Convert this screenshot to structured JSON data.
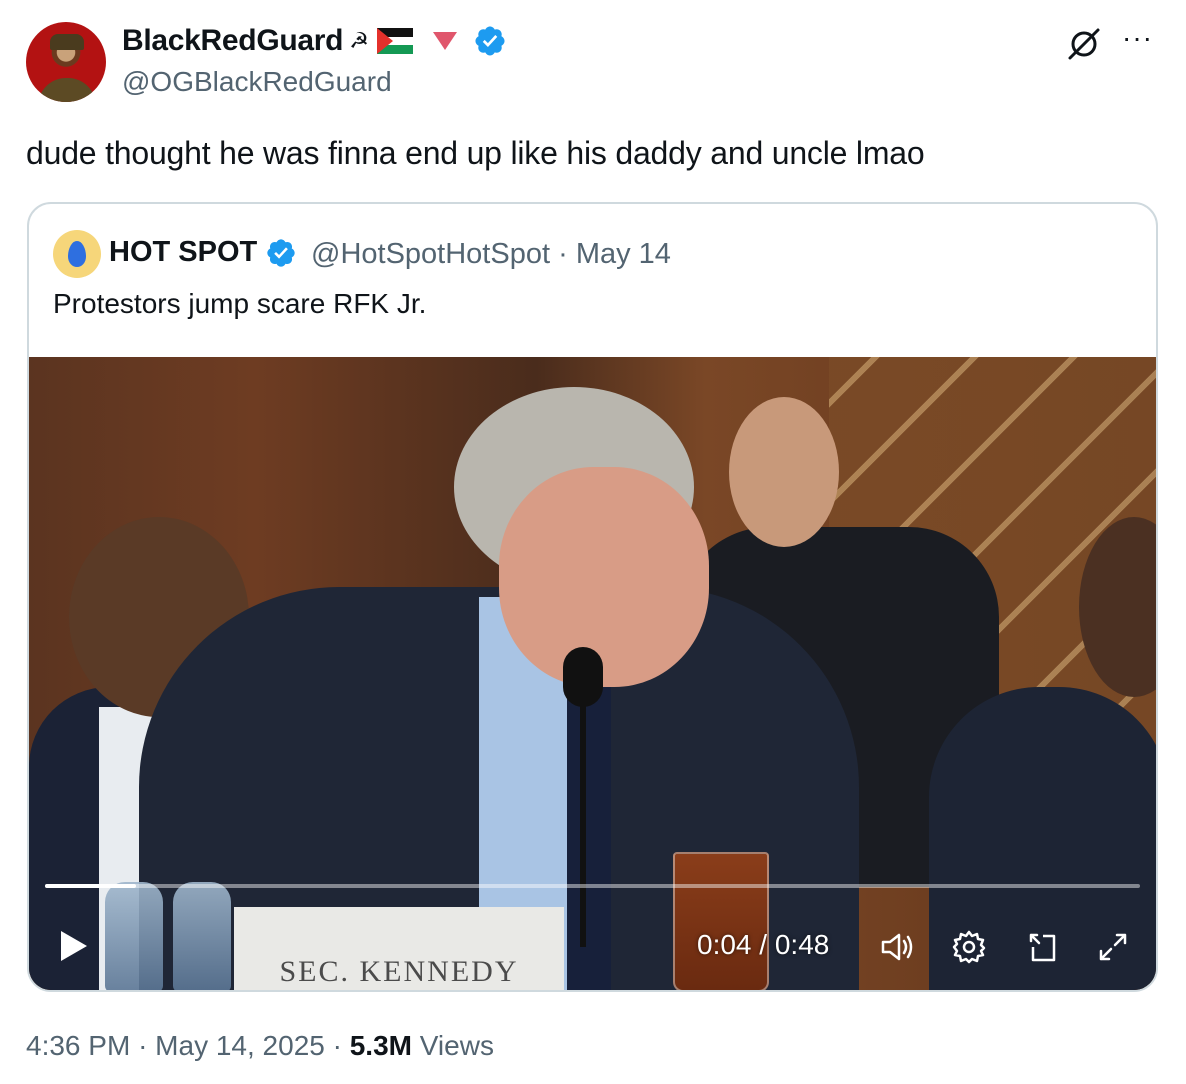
{
  "author": {
    "name": "BlackRedGuard",
    "name_emoji": "☭",
    "handle": "@OGBlackRedGuard"
  },
  "tweet": {
    "text": "dude thought he was finna end up like his daddy and uncle lmao"
  },
  "quoted": {
    "name": "HOT SPOT",
    "handle": "@HotSpotHotSpot",
    "date": "May 14",
    "separator": "·",
    "text": "Protestors jump scare RFK Jr."
  },
  "video": {
    "nameplate": "SEC. KENNEDY",
    "current_time": "0:04",
    "duration": "0:48",
    "time_separator": " / ",
    "progress": 0.083
  },
  "meta": {
    "time": "4:36 PM",
    "date": "May 14, 2025",
    "separator": "·",
    "views_count": "5.3M",
    "views_label": "Views"
  },
  "icons": {
    "more": "more-icon",
    "grok": "grok-icon",
    "verified": "verified-badge-icon",
    "play": "play-icon",
    "volume": "volume-icon",
    "settings": "settings-icon",
    "pip": "picture-in-picture-icon",
    "fullscreen": "fullscreen-icon"
  },
  "colors": {
    "verified": "#1d9bf0",
    "text_primary": "#0f1419",
    "text_secondary": "#536471",
    "border": "#cfd9de"
  }
}
